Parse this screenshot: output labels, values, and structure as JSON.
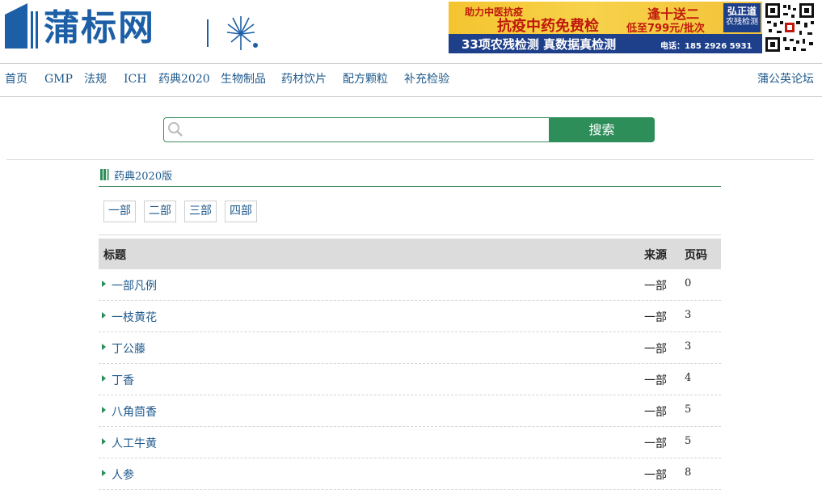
{
  "header": {
    "logo_text": "蒲标网",
    "ad": {
      "line1": "助力中医抗疫",
      "line2": "抗疫中药免费检",
      "line3": "逢十送二",
      "line4": "低至799元/批次",
      "line5": "33项农残检测 真数据真检测",
      "line6": "电话：185 2926 5931",
      "brand_name": "弘正道",
      "brand_sub": "农残检测"
    }
  },
  "nav": {
    "items": [
      {
        "label": "首页"
      },
      {
        "label": "GMP"
      },
      {
        "label": "法规"
      },
      {
        "label": "ICH"
      },
      {
        "label": "药典2020"
      },
      {
        "label": "生物制品"
      },
      {
        "label": "药材饮片"
      },
      {
        "label": "配方颗粒"
      },
      {
        "label": "补充检验"
      }
    ],
    "right_label": "蒲公英论坛"
  },
  "search": {
    "placeholder": "",
    "button_label": "搜索"
  },
  "section": {
    "title": "药典2020版",
    "parts": [
      {
        "label": "一部"
      },
      {
        "label": "二部"
      },
      {
        "label": "三部"
      },
      {
        "label": "四部"
      }
    ]
  },
  "table": {
    "headers": {
      "title": "标题",
      "source": "来源",
      "page": "页码"
    },
    "rows": [
      {
        "title": "一部凡例",
        "source": "一部",
        "page": "0"
      },
      {
        "title": "一枝黄花",
        "source": "一部",
        "page": "3"
      },
      {
        "title": "丁公藤",
        "source": "一部",
        "page": "3"
      },
      {
        "title": "丁香",
        "source": "一部",
        "page": "4"
      },
      {
        "title": "八角茴香",
        "source": "一部",
        "page": "5"
      },
      {
        "title": "人工牛黄",
        "source": "一部",
        "page": "5"
      },
      {
        "title": "人参",
        "source": "一部",
        "page": "8"
      }
    ]
  },
  "colors": {
    "brand_blue": "#1d5fa6",
    "link_blue": "#1f5a8c",
    "accent_green": "#2e8e5a"
  }
}
